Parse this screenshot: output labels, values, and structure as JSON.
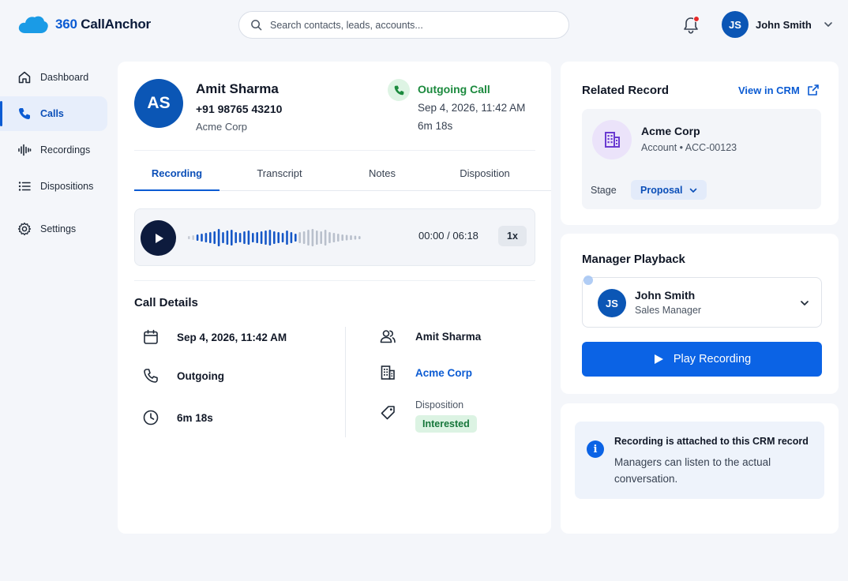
{
  "header": {
    "logo_number": "360",
    "logo_name": "CallAnchor",
    "search_placeholder": "Search contacts, leads, accounts...",
    "user_initials": "JS",
    "user_name": "John Smith"
  },
  "sidebar": {
    "items": [
      {
        "label": "Dashboard",
        "icon": "home-icon"
      },
      {
        "label": "Calls",
        "icon": "phone-icon",
        "active": true
      },
      {
        "label": "Recordings",
        "icon": "waveform-icon"
      },
      {
        "label": "Dispositions",
        "icon": "list-icon"
      },
      {
        "label": "Settings",
        "icon": "gear-icon"
      }
    ]
  },
  "contact": {
    "initials": "AS",
    "name": "Amit Sharma",
    "phone": "+91 98765 43210",
    "company": "Acme Corp"
  },
  "call": {
    "type": "Outgoing Call",
    "datetime": "Sep 4, 2026, 11:42 AM",
    "duration": "6m 18s"
  },
  "tabs": [
    "Recording",
    "Transcript",
    "Notes",
    "Disposition"
  ],
  "active_tab": "Recording",
  "player": {
    "time": "00:00 / 06:18",
    "speed": "1x",
    "progress": 0
  },
  "details": {
    "title": "Call Details",
    "date": "Sep 4, 2026, 11:42 AM",
    "direction": "Outgoing",
    "duration": "6m 18s",
    "contact": "Amit Sharma",
    "company": "Acme Corp",
    "disposition_label": "Disposition",
    "disposition_value": "Interested"
  },
  "related": {
    "title": "Related Record",
    "view_link": "View in CRM",
    "account_name": "Acme Corp",
    "account_sub": "Account • ACC-00123",
    "stage_label": "Stage",
    "stage_value": "Proposal"
  },
  "manager": {
    "title": "Manager Playback",
    "initials": "JS",
    "name": "John Smith",
    "role": "Sales Manager",
    "play_label": "Play Recording"
  },
  "info": {
    "title": "Recording is attached to this CRM record",
    "text": "Managers can listen to the actual conversation."
  },
  "colors": {
    "brand": "#0b5bd3",
    "avatar": "#0b56b5",
    "success": "#1c8a3e",
    "dark": "#0d1b3d"
  }
}
